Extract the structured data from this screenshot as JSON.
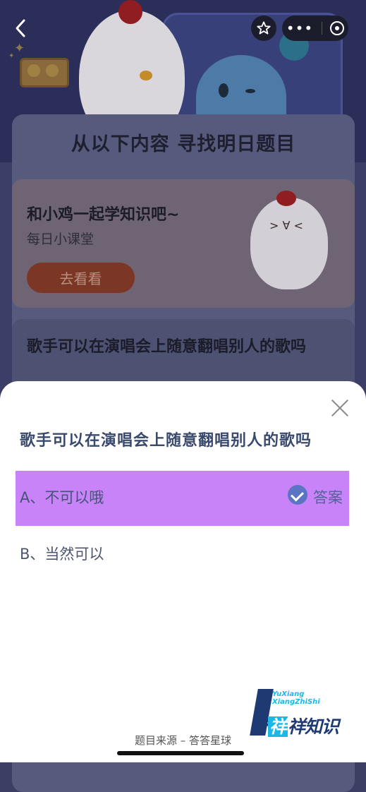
{
  "background": {
    "panel_title": "从以下内容  寻找明日题目",
    "lesson_card": {
      "title": "和小鸡一起学知识吧~",
      "subtitle": "每日小课堂",
      "button": "去看看"
    },
    "question_card": {
      "text": "歌手可以在演唱会上随意翻唱别人的歌吗"
    }
  },
  "header": {
    "back_icon": "chevron-left-icon",
    "favorite_icon": "star-icon",
    "more_icon": "more-dots-icon",
    "close_miniapp_icon": "target-icon"
  },
  "sheet": {
    "question": "歌手可以在演唱会上随意翻唱别人的歌吗",
    "options": [
      {
        "label": "A、不可以哦",
        "correct": true,
        "tag": "答案"
      },
      {
        "label": "B、当然可以",
        "correct": false
      }
    ],
    "source": "题目来源 – 答答星球",
    "highlight_color": "#c883f8"
  },
  "watermark": {
    "line1": "YuXiang",
    "line2": "XiangZhiShi",
    "brand_a": "誉",
    "brand_b": "祥",
    "brand_c": "祥知识"
  }
}
